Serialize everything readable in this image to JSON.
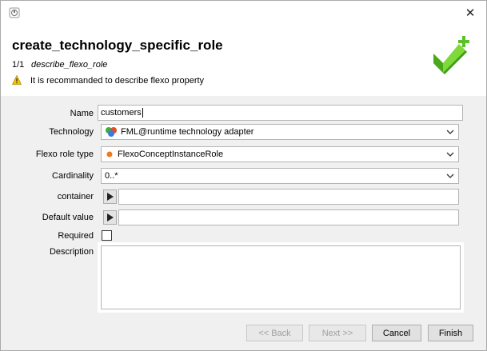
{
  "window": {
    "close_glyph": "✕"
  },
  "header": {
    "title": "create_technology_specific_role",
    "step_count": "1/1",
    "step_name": "describe_flexo_role",
    "warning": "It is recommanded to describe flexo property"
  },
  "form": {
    "name": {
      "label": "Name",
      "value": "customers"
    },
    "technology": {
      "label": "Technology",
      "value": "FML@runtime technology adapter"
    },
    "flexo_role_type": {
      "label": "Flexo role type",
      "value": "FlexoConceptInstanceRole"
    },
    "cardinality": {
      "label": "Cardinality",
      "value": "0..*"
    },
    "container": {
      "label": "container",
      "value": ""
    },
    "default_value": {
      "label": "Default value",
      "value": ""
    },
    "required": {
      "label": "Required",
      "checked": false
    },
    "description": {
      "label": "Description",
      "value": ""
    }
  },
  "buttons": {
    "back": "<< Back",
    "next": "Next >>",
    "cancel": "Cancel",
    "finish": "Finish"
  },
  "colors": {
    "accent_green": "#5cc02a",
    "warning_yellow": "#f5c400"
  }
}
